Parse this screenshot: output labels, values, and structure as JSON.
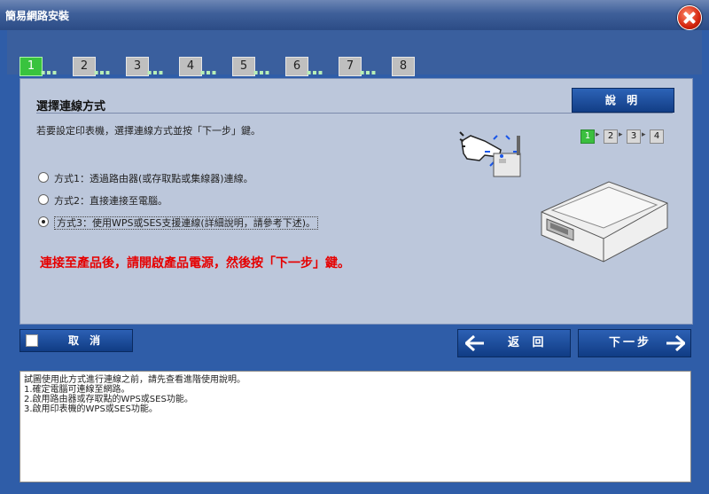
{
  "window": {
    "title": "簡易網路安裝"
  },
  "steps": [
    {
      "label": "1",
      "active": true
    },
    {
      "label": "2"
    },
    {
      "label": "3"
    },
    {
      "label": "4"
    },
    {
      "label": "5"
    },
    {
      "label": "6"
    },
    {
      "label": "7"
    },
    {
      "label": "8"
    }
  ],
  "panel": {
    "title": "選擇連線方式",
    "help_label": "說 明",
    "instruction": "若要設定印表機，選擇連線方式並按「下一步」鍵。",
    "substeps": [
      "1",
      "2",
      "3",
      "4"
    ],
    "options": [
      {
        "label": "方式1：透過路由器(或存取點或集線器)連線。",
        "selected": false
      },
      {
        "label": "方式2：直接連接至電腦。",
        "selected": false
      },
      {
        "label": "方式3：使用WPS或SES支援連線(詳細說明，請參考下述)。",
        "selected": true
      }
    ],
    "notice": "連接至產品後，請開啟產品電源，然後按「下一步」鍵。"
  },
  "buttons": {
    "cancel": "取 消",
    "back": "返 回",
    "next": "下一步"
  },
  "info": {
    "lines": [
      "試圖使用此方式進行連線之前，請先查看進階使用說明。",
      "1.確定電腦可連線至網路。",
      "2.啟用路由器或存取點的WPS或SES功能。",
      "3.啟用印表機的WPS或SES功能。"
    ]
  },
  "colors": {
    "accent_green": "#39c33e",
    "notice_red": "#e60000",
    "button_blue": "#1a4a96"
  }
}
